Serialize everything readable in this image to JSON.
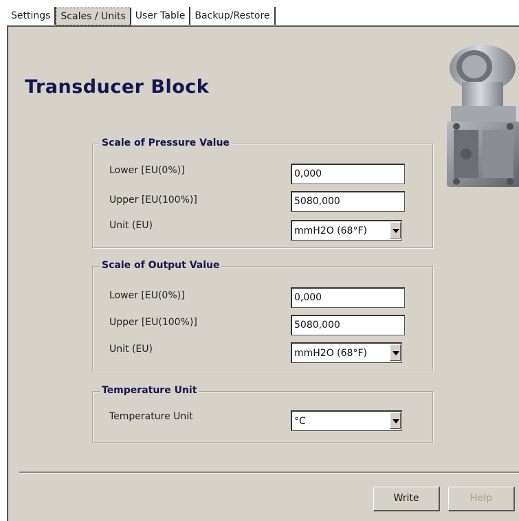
{
  "tabs": [
    "Settings",
    "Scales / Units",
    "User Table",
    "Backup/Restore"
  ],
  "title": "Transducer Block",
  "pressure": {
    "legend": "Scale of Pressure Value",
    "lower_label": "Lower [EU(0%)]",
    "lower_value": "0,000",
    "upper_label": "Upper [EU(100%)]",
    "upper_value": "5080,000",
    "unit_label": "Unit (EU)",
    "unit_value": "mmH2O (68°F)"
  },
  "output": {
    "legend": "Scale of Output Value",
    "lower_label": "Lower [EU(0%)]",
    "lower_value": "0,000",
    "upper_label": "Upper [EU(100%)]",
    "upper_value": "5080,000",
    "unit_label": "Unit (EU)",
    "unit_value": "mmH2O (68°F)"
  },
  "temperature": {
    "legend": "Temperature Unit",
    "unit_label": "Temperature Unit",
    "unit_value": "°C"
  },
  "buttons": {
    "write": "Write",
    "help": "Help"
  },
  "colors": {
    "panel": "#d6d2c9",
    "title": "#14164e",
    "disabled_text": "#a09c93"
  },
  "icons": {
    "dropdown": "chevron-down-icon",
    "device": "pressure-transmitter-image"
  }
}
